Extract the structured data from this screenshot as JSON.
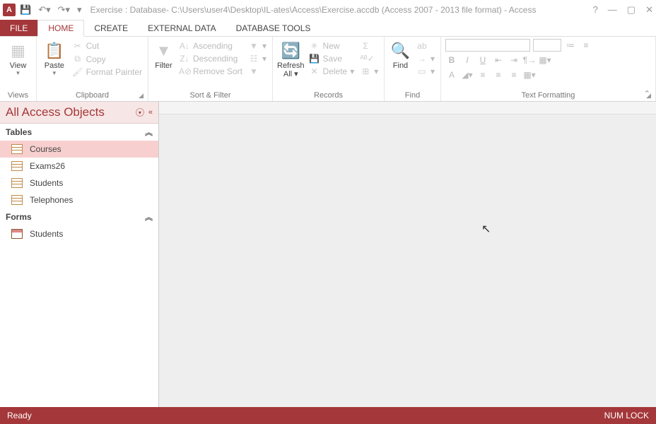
{
  "titlebar": {
    "app_letter": "A",
    "title": "Exercise : Database- C:\\Users\\user4\\Desktop\\IL-ates\\Access\\Exercise.accdb (Access 2007 - 2013 file format) - Access"
  },
  "tabs": {
    "file": "FILE",
    "home": "HOME",
    "create": "CREATE",
    "external": "EXTERNAL DATA",
    "dbtools": "DATABASE TOOLS"
  },
  "ribbon": {
    "views": {
      "label": "Views",
      "view": "View"
    },
    "clipboard": {
      "label": "Clipboard",
      "paste": "Paste",
      "cut": "Cut",
      "copy": "Copy",
      "format_painter": "Format Painter"
    },
    "sortfilter": {
      "label": "Sort & Filter",
      "filter": "Filter",
      "ascending": "Ascending",
      "descending": "Descending",
      "remove_sort": "Remove Sort"
    },
    "records": {
      "label": "Records",
      "refresh": "Refresh All",
      "new": "New",
      "save": "Save",
      "delete": "Delete"
    },
    "find": {
      "label": "Find",
      "find": "Find"
    },
    "textfmt": {
      "label": "Text Formatting",
      "bold": "B",
      "italic": "I",
      "underline": "U",
      "a": "A"
    }
  },
  "navpane": {
    "header": "All Access Objects",
    "sections": {
      "tables": "Tables",
      "forms": "Forms"
    },
    "tables": [
      "Courses",
      "Exams26",
      "Students",
      "Telephones"
    ],
    "forms": [
      "Students"
    ],
    "selected_table": "Courses"
  },
  "statusbar": {
    "left": "Ready",
    "right": "NUM LOCK"
  }
}
